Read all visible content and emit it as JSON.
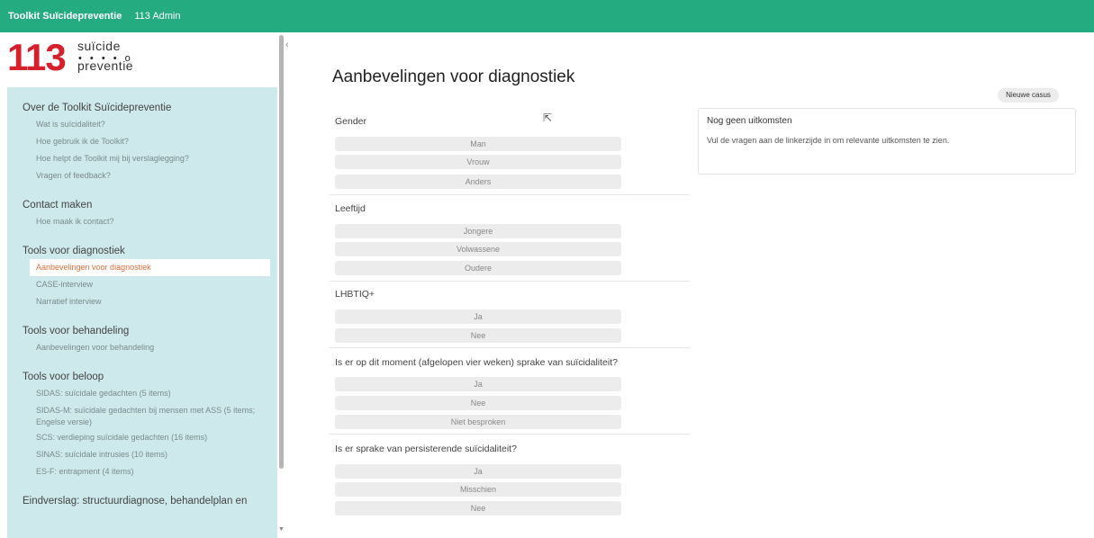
{
  "topbar": {
    "app_name": "Toolkit Suïcidepreventie",
    "user": "113 Admin"
  },
  "logo": {
    "number": "113",
    "word1": "suïcide",
    "dots": "• • • • o",
    "word2": "preventie"
  },
  "nav": {
    "s1": "Over de Toolkit Suïcidepreventie",
    "s1_items": [
      "Wat is suïcidaliteit?",
      "Hoe gebruik ik de Toolkit?",
      "Hoe helpt de Toolkit mij bij verslaglegging?",
      "Vragen of feedback?"
    ],
    "s2": "Contact maken",
    "s2_items": [
      "Hoe maak ik contact?"
    ],
    "s3": "Tools voor diagnostiek",
    "s3_items": [
      "Aanbevelingen voor diagnostiek",
      "CASE-interview",
      "Narratief interview"
    ],
    "s4": "Tools voor behandeling",
    "s4_items": [
      "Aanbevelingen voor behandeling"
    ],
    "s5": "Tools voor beloop",
    "s5_items": [
      "SIDAS: suïcidale gedachten (5 items)",
      "SIDAS-M: suïcidale gedachten bij mensen met ASS (5 items; Engelse versie)",
      "SCS: verdieping suïcidale gedachten (16 items)",
      "SINAS: suïcidale intrusies (10 items)",
      "ES-F: entrapment (4 items)"
    ],
    "s6": "Eindverslag: structuurdiagnose, behandelplan en"
  },
  "ui": {
    "collapse": "‹",
    "scroll_down": "▼",
    "cursor": "⇱"
  },
  "main": {
    "title": "Aanbevelingen voor diagnostiek",
    "new_case": "Nieuwe casus",
    "q1": "Gender",
    "q1_opts": [
      "Man",
      "Vrouw",
      "Anders"
    ],
    "q2": "Leeftijd",
    "q2_opts": [
      "Jongere",
      "Volwassene",
      "Oudere"
    ],
    "q3": "LHBTIQ+",
    "q3_opts": [
      "Ja",
      "Nee"
    ],
    "q4": "Is er op dit moment (afgelopen vier weken) sprake van suïcidaliteit?",
    "q4_opts": [
      "Ja",
      "Nee",
      "Niet besproken"
    ],
    "q5": "Is er sprake van persisterende suïcidaliteit?",
    "q5_opts": [
      "Ja",
      "Misschien",
      "Nee"
    ]
  },
  "results": {
    "title": "Nog geen uitkomsten",
    "text": "Vul de vragen aan de linkerzijde in om relevante uitkomsten te zien."
  }
}
